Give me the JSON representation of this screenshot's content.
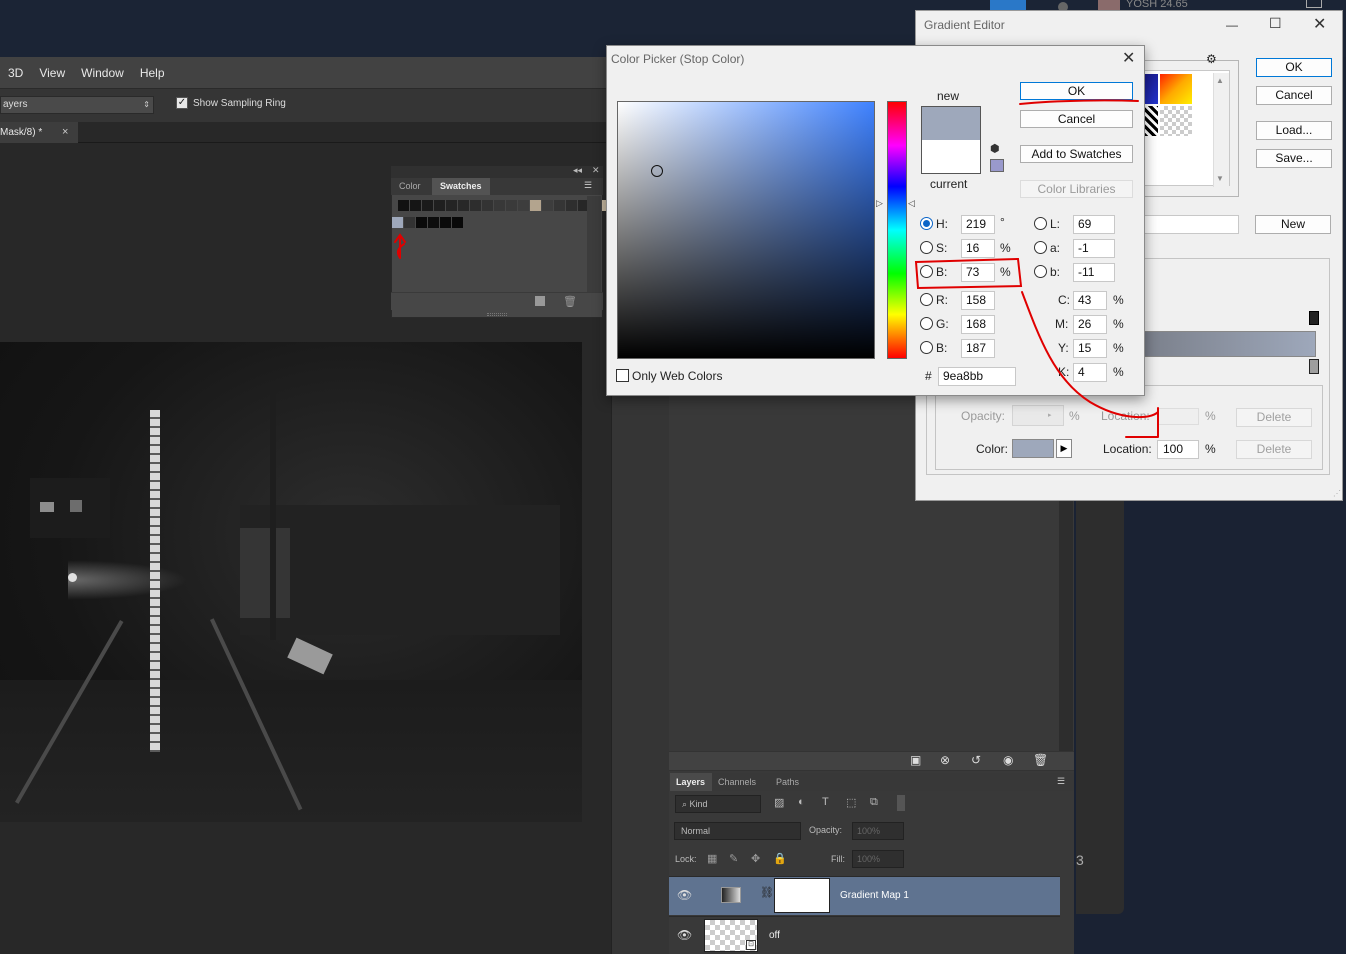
{
  "taskbar": {
    "user_text": "YOSH  24.65"
  },
  "menu": [
    "3D",
    "View",
    "Window",
    "Help"
  ],
  "options_bar": {
    "sample_select": "ayers",
    "show_sampling_ring_label": "Show Sampling Ring",
    "show_sampling_ring_checked": true
  },
  "doc_tab": {
    "title": "Mask/8) *",
    "close": "×"
  },
  "swatches_panel": {
    "tabs": [
      "Color",
      "Swatches"
    ],
    "active_tab": "Swatches",
    "row1_colors": [
      "#111111",
      "#151515",
      "#1a1a1a",
      "#1f1f1f",
      "#242424",
      "#282828",
      "#2d2d2d",
      "#333333",
      "#383838",
      "#3a3a3a",
      "#3d3d3d",
      "#b3a48e",
      "#3d3d3d",
      "#353535",
      "#2e2e2e",
      "#272727",
      "#202020",
      "#c9bba3"
    ],
    "row2_colors": [
      "#9ea8bb",
      "#333333",
      "#0a0a0a",
      "#0d0d0d",
      "#0a0a0a",
      "#090909"
    ]
  },
  "layers_panel": {
    "tabs": [
      "Layers",
      "Channels",
      "Paths"
    ],
    "kind_filter": "Kind",
    "blend_mode": "Normal",
    "opacity_label": "Opacity:",
    "opacity_value": "100%",
    "lock_label": "Lock:",
    "fill_label": "Fill:",
    "fill_value": "100%",
    "layers": [
      {
        "name": "Gradient Map 1",
        "selected": true
      },
      {
        "name": "off",
        "selected": false
      }
    ]
  },
  "gradient_editor": {
    "title": "Gradient Editor",
    "buttons": {
      "ok": "OK",
      "cancel": "Cancel",
      "load": "Load...",
      "save": "Save...",
      "new": "New"
    },
    "stops": {
      "opacity_label": "Opacity:",
      "opacity_unit": "%",
      "location_label_disabled": "Location:",
      "location_unit": "%",
      "delete": "Delete",
      "color_label": "Color:",
      "color_value": "#9ea8bb",
      "location_label": "Location:",
      "location_value": "100"
    }
  },
  "color_picker": {
    "title": "Color Picker (Stop Color)",
    "new_label": "new",
    "current_label": "current",
    "new_color": "#9ea8bb",
    "current_color": "#ffffff",
    "buttons": {
      "ok": "OK",
      "cancel": "Cancel",
      "add_to_swatches": "Add to Swatches",
      "color_libraries": "Color Libraries"
    },
    "hsb": {
      "H": "219",
      "S": "16",
      "B": "73"
    },
    "rgb": {
      "R": "158",
      "G": "168",
      "B": "187"
    },
    "lab": {
      "L": "69",
      "a": "-1",
      "b": "-11"
    },
    "cmyk": {
      "C": "43",
      "M": "26",
      "Y": "15",
      "K": "4"
    },
    "units": {
      "degree": "°",
      "percent": "%"
    },
    "only_web_colors_label": "Only Web Colors",
    "hash": "#",
    "hex": "9ea8bb",
    "selected_mode": "H"
  },
  "annotation_color": "#e00000"
}
